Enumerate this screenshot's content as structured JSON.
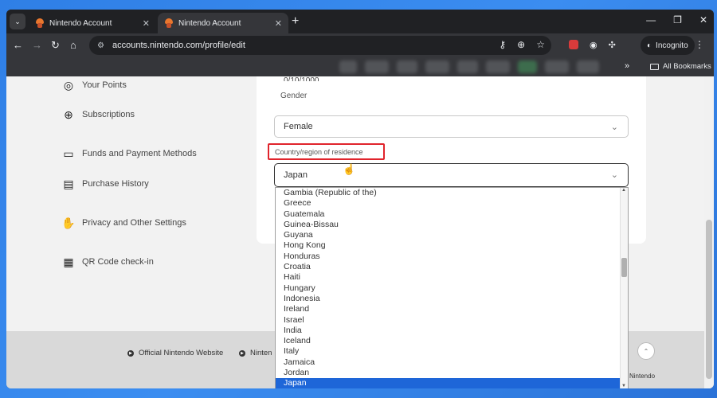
{
  "browser": {
    "tabs": [
      {
        "title": "Nintendo Account",
        "active": false
      },
      {
        "title": "Nintendo Account",
        "active": true
      }
    ],
    "url": "accounts.nintendo.com/profile/edit",
    "incognito_label": "Incognito",
    "all_bookmarks_label": "All Bookmarks"
  },
  "sidebar": {
    "items": [
      {
        "label": "Your Points",
        "icon": "points-icon"
      },
      {
        "label": "Subscriptions",
        "icon": "globe-icon"
      },
      {
        "label": "Funds and Payment Methods",
        "icon": "card-icon"
      },
      {
        "label": "Purchase History",
        "icon": "receipt-icon"
      },
      {
        "label": "Privacy and Other Settings",
        "icon": "hand-icon"
      },
      {
        "label": "QR Code check-in",
        "icon": "qr-icon"
      }
    ]
  },
  "form": {
    "birthday_partial": "0/10/1000",
    "gender_label": "Gender",
    "gender_value": "Female",
    "country_label": "Country/region of residence",
    "country_value": "Japan"
  },
  "dropdown": {
    "options": [
      "Gambia (Republic of the)",
      "Greece",
      "Guatemala",
      "Guinea-Bissau",
      "Guyana",
      "Hong Kong",
      "Honduras",
      "Croatia",
      "Haiti",
      "Hungary",
      "Indonesia",
      "Ireland",
      "Israel",
      "India",
      "Iceland",
      "Italy",
      "Jamaica",
      "Jordan",
      "Japan"
    ],
    "selected": "Japan"
  },
  "footer": {
    "links": [
      "Official Nintendo Website",
      "Ninten"
    ],
    "copyright": "Nintendo"
  },
  "colors": {
    "highlight_border": "#e0242c",
    "selected_option_bg": "#1e66d8"
  }
}
